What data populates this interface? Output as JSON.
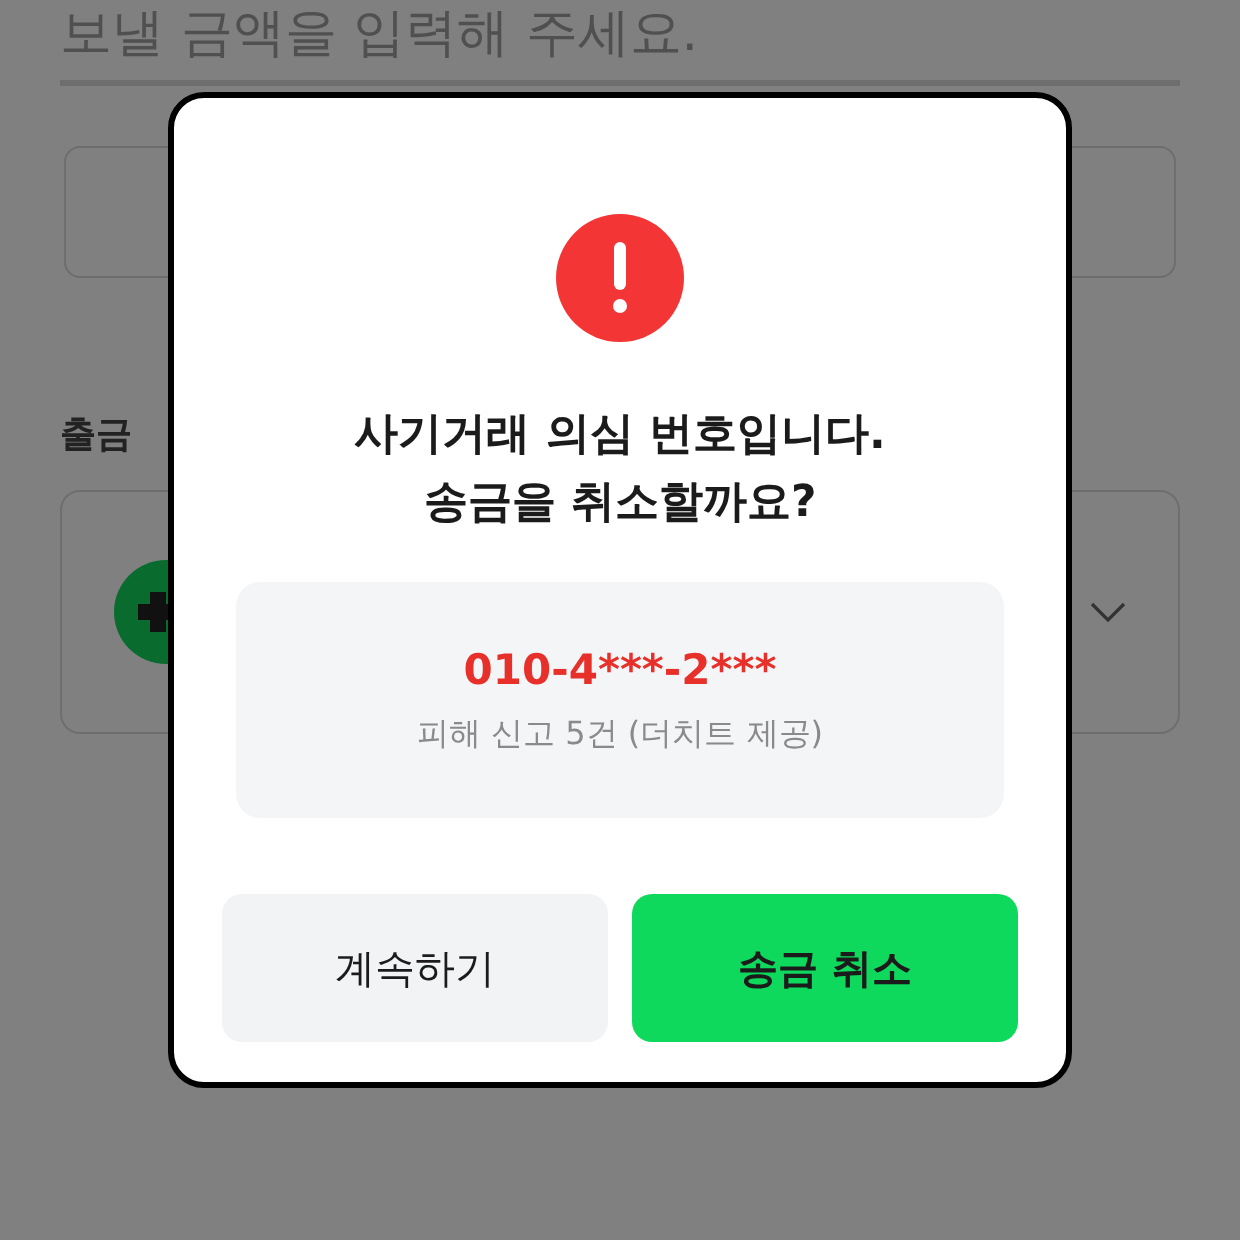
{
  "background": {
    "amount_field": {
      "placeholder": "보낼 금액을 입력해 주세요."
    },
    "section_label": "출금"
  },
  "dialog": {
    "title_lines": [
      "사기거래 의심 번호입니다.",
      "송금을 취소할까요?"
    ],
    "phone": "010-4***-2***",
    "report_note": "피해 신고 5건 (더치트 제공)",
    "buttons": [
      {
        "label": "계속하기",
        "kind": "secondary"
      },
      {
        "label": "송금 취소",
        "kind": "primary"
      }
    ]
  }
}
